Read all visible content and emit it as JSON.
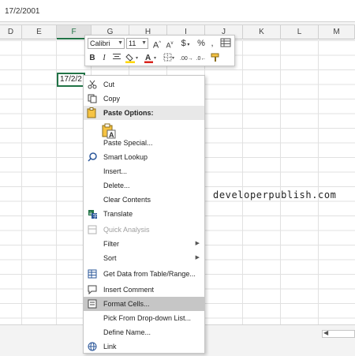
{
  "formula_bar": {
    "value": "17/2/2001"
  },
  "columns": [
    {
      "id": "D",
      "label": "D"
    },
    {
      "id": "E",
      "label": "E"
    },
    {
      "id": "F",
      "label": "F"
    },
    {
      "id": "G",
      "label": "G"
    },
    {
      "id": "H",
      "label": "H"
    },
    {
      "id": "I",
      "label": "I"
    },
    {
      "id": "J",
      "label": "J"
    },
    {
      "id": "K",
      "label": "K"
    },
    {
      "id": "L",
      "label": "L"
    },
    {
      "id": "M",
      "label": "M"
    }
  ],
  "active_cell": {
    "value": "17/2/2"
  },
  "watermark": "developerpublish.com",
  "mini_toolbar": {
    "font_name": "Calibri",
    "font_size": "11",
    "grow_font": "A",
    "shrink_font": "A",
    "currency": "$",
    "percent": "%",
    "comma": ",",
    "bold": "B",
    "italic": "I",
    "font_color_glyph": "A",
    "colors": {
      "fill": "#ffd700",
      "font": "#d9241c"
    }
  },
  "context_menu": {
    "items": [
      {
        "key": "cut",
        "label": "Cut"
      },
      {
        "key": "copy",
        "label": "Copy"
      },
      {
        "key": "paste_options",
        "label": "Paste Options:"
      },
      {
        "key": "paste_special",
        "label": "Paste Special..."
      },
      {
        "key": "smart_lookup",
        "label": "Smart Lookup"
      },
      {
        "key": "insert",
        "label": "Insert..."
      },
      {
        "key": "delete",
        "label": "Delete..."
      },
      {
        "key": "clear_contents",
        "label": "Clear Contents"
      },
      {
        "key": "translate",
        "label": "Translate"
      },
      {
        "key": "quick_analysis",
        "label": "Quick Analysis"
      },
      {
        "key": "filter",
        "label": "Filter"
      },
      {
        "key": "sort",
        "label": "Sort"
      },
      {
        "key": "get_data",
        "label": "Get Data from Table/Range..."
      },
      {
        "key": "insert_comment",
        "label": "Insert Comment"
      },
      {
        "key": "format_cells",
        "label": "Format Cells..."
      },
      {
        "key": "pick_dropdown",
        "label": "Pick From Drop-down List..."
      },
      {
        "key": "define_name",
        "label": "Define Name..."
      },
      {
        "key": "link",
        "label": "Link"
      }
    ]
  }
}
